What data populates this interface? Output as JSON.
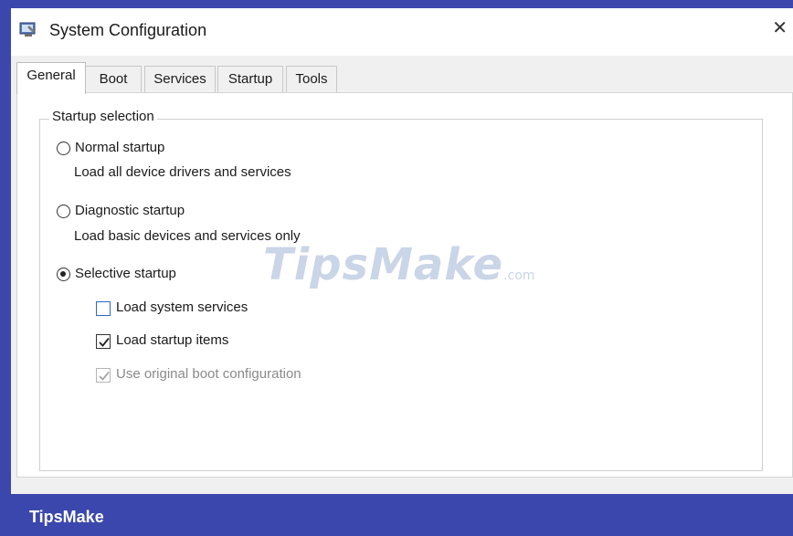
{
  "window": {
    "title": "System Configuration",
    "close_glyph": "✕"
  },
  "tabs": [
    {
      "label": "General",
      "active": true
    },
    {
      "label": "Boot",
      "active": false
    },
    {
      "label": "Services",
      "active": false
    },
    {
      "label": "Startup",
      "active": false
    },
    {
      "label": "Tools",
      "active": false
    }
  ],
  "startup_selection": {
    "legend": "Startup selection",
    "normal": {
      "label": "Normal startup",
      "description": "Load all device drivers and services",
      "selected": false
    },
    "diagnostic": {
      "label": "Diagnostic startup",
      "description": "Load basic devices and services only",
      "selected": false
    },
    "selective": {
      "label": "Selective startup",
      "selected": true
    },
    "checkboxes": [
      {
        "label": "Load system services",
        "checked": false,
        "enabled": true
      },
      {
        "label": "Load startup items",
        "checked": true,
        "enabled": true
      },
      {
        "label": "Use original boot configuration",
        "checked": true,
        "enabled": false
      }
    ]
  },
  "watermark": {
    "text": "TipsMake",
    "suffix": ".com"
  },
  "footer": {
    "brand": "TipsMake"
  },
  "colors": {
    "frame": "#3b47ad",
    "dialog_bg": "#f0f0f0",
    "panel_bg": "#ffffff"
  },
  "icons": {
    "app": "system-config-icon",
    "close": "close-icon"
  }
}
